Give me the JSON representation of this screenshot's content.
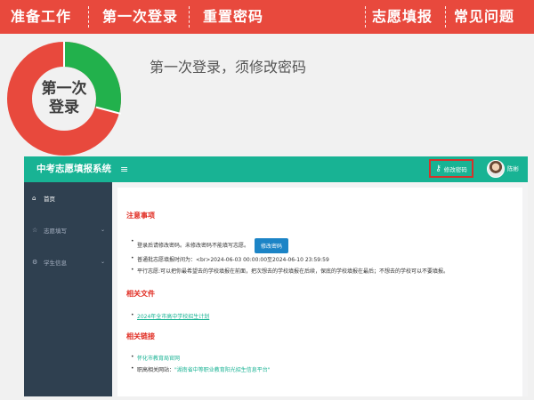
{
  "top_nav": {
    "left": [
      "准备工作",
      "第一次登录",
      "重置密码"
    ],
    "right": [
      "志愿填报",
      "常见问题"
    ]
  },
  "donut": {
    "label_line1": "第一次",
    "label_line2": "登录",
    "colors": {
      "red": "#e8493d",
      "green": "#22b14c"
    }
  },
  "heading": "第一次登录，须修改密码",
  "app": {
    "title": "中考志愿填报系统",
    "menu_icon": "≡",
    "change_password_label": "修改密码",
    "username": "陈彬",
    "sidebar": [
      {
        "icon": "home-icon",
        "label": "首页",
        "active": true
      },
      {
        "icon": "star-icon",
        "label": "志愿填写",
        "active": false
      },
      {
        "icon": "gear-icon",
        "label": "学生信息",
        "active": false
      }
    ],
    "notice": {
      "title": "注意事项",
      "items": [
        "登录后请修改密码。未修改密码不能填写志愿。",
        "普通批志愿填报时间为：<br>2024-06-03 00:00:00至2024-06-10 23:59:59",
        "平行志愿:可以把你最希望去的学校填报在前面，把次想去的学校填报在后续，保底的学校填报在最后；不想去的学校可以不要填报。"
      ],
      "button_label": "修改密码"
    },
    "files": {
      "title": "相关文件",
      "items": [
        "2024年全市高中学校招生计划"
      ]
    },
    "links": {
      "title": "相关链接",
      "item1": "怀化市教育局官网",
      "item2_prefix": "职高相关网站：",
      "item2_link": "\"湖南省中等职业教育阳光招生信息平台\""
    }
  },
  "colors": {
    "banner": "#e8493d",
    "app_header": "#18b394",
    "sidebar": "#2f4050",
    "section_title": "#e02a20",
    "button": "#1c84c6",
    "highlight_box": "#d6322a"
  }
}
